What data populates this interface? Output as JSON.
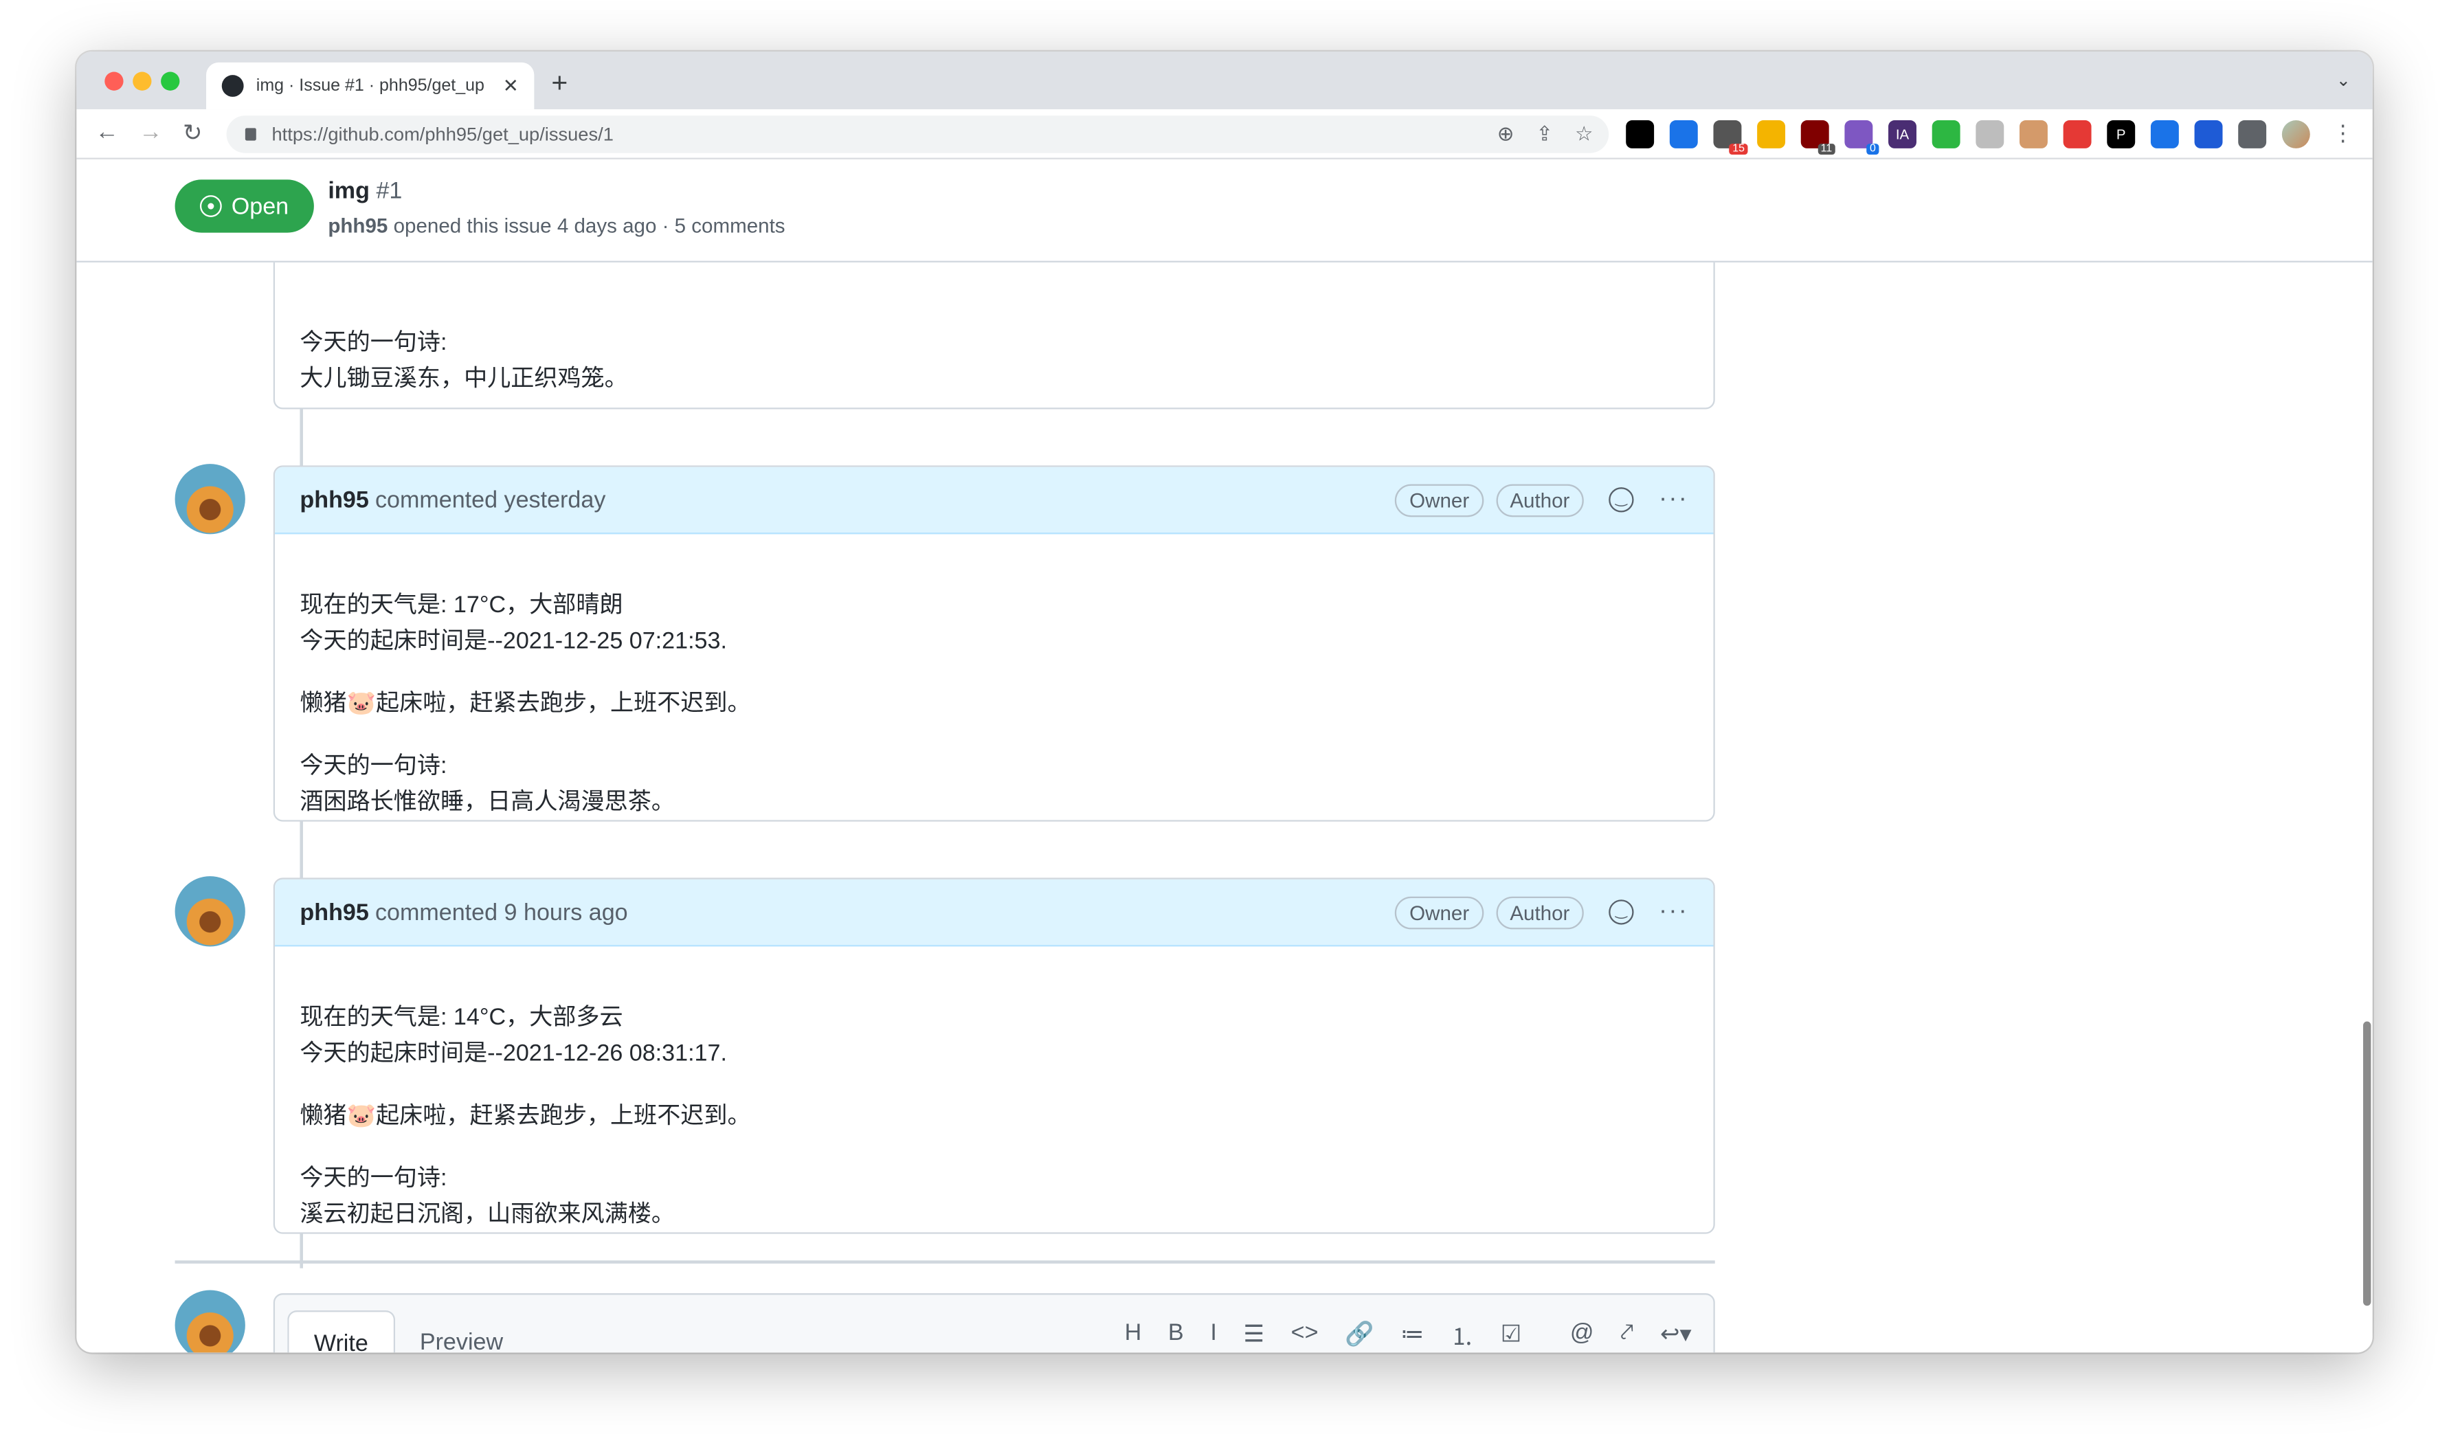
{
  "browser": {
    "tab_title": "img · Issue #1 · phh95/get_up",
    "url": "https://github.com/phh95/get_up/issues/1",
    "extensions": [
      {
        "name": "ext-dark",
        "color": "#000000"
      },
      {
        "name": "ext-blue-circle",
        "color": "#1a73e8"
      },
      {
        "name": "ext-grid",
        "color": "#555555",
        "badge": "15",
        "badge_color": "#e53935"
      },
      {
        "name": "ext-download",
        "color": "#f4b400"
      },
      {
        "name": "ext-ublock",
        "color": "#800000",
        "badge": "11",
        "badge_color": "#555555"
      },
      {
        "name": "ext-sync",
        "color": "#7e57c2",
        "badge": "0",
        "badge_color": "#1a73e8"
      },
      {
        "name": "ext-ia",
        "color": "#4a2d73",
        "text": "IA"
      },
      {
        "name": "ext-y",
        "color": "#2db742"
      },
      {
        "name": "ext-shield",
        "color": "#bdbdbd"
      },
      {
        "name": "ext-face",
        "color": "#d49a6a"
      },
      {
        "name": "ext-red-list",
        "color": "#e53935"
      },
      {
        "name": "ext-p",
        "color": "#000000",
        "text": "P"
      },
      {
        "name": "ext-file-down",
        "color": "#1a73e8"
      },
      {
        "name": "ext-scissors",
        "color": "#1e5bd6"
      },
      {
        "name": "ext-puzzle",
        "color": "#5f6368"
      }
    ]
  },
  "issue": {
    "state": "Open",
    "title": "img",
    "number": "#1",
    "author": "phh95",
    "meta": "opened this issue 4 days ago · 5 comments",
    "accent": "#2da44e"
  },
  "partial_comment": {
    "lines": [
      "今天的一句诗:",
      "大儿锄豆溪东，中儿正织鸡笼。"
    ]
  },
  "comments": [
    {
      "author": "phh95",
      "action": "commented yesterday",
      "badges": [
        "Owner",
        "Author"
      ],
      "paragraphs": [
        [
          "现在的天气是: 17°C，大部晴朗",
          "今天的起床时间是--2021-12-25 07:21:53."
        ],
        [
          "懒猪🐷起床啦，赶紧去跑步，上班不迟到。"
        ],
        [
          "今天的一句诗:",
          "酒困路长惟欲睡，日高人渴漫思茶。"
        ]
      ]
    },
    {
      "author": "phh95",
      "action": "commented 9 hours ago",
      "badges": [
        "Owner",
        "Author"
      ],
      "paragraphs": [
        [
          "现在的天气是: 14°C，大部多云",
          "今天的起床时间是--2021-12-26 08:31:17."
        ],
        [
          "懒猪🐷起床啦，赶紧去跑步，上班不迟到。"
        ],
        [
          "今天的一句诗:",
          "溪云初起日沉阁，山雨欲来风满楼。"
        ]
      ]
    }
  ],
  "editor": {
    "tabs": [
      "Write",
      "Preview"
    ],
    "tools": [
      {
        "icon": "heading-icon",
        "glyph": "H"
      },
      {
        "icon": "bold-icon",
        "glyph": "B"
      },
      {
        "icon": "italic-icon",
        "glyph": "I"
      },
      {
        "icon": "quote-icon",
        "glyph": "☰"
      },
      {
        "icon": "code-icon",
        "glyph": "<>"
      },
      {
        "icon": "link-icon",
        "glyph": "🔗"
      },
      {
        "icon": "bullet-list-icon",
        "glyph": "≔"
      },
      {
        "icon": "numbered-list-icon",
        "glyph": "⒈"
      },
      {
        "icon": "task-list-icon",
        "glyph": "☑"
      },
      {
        "icon": "mention-icon",
        "glyph": "@"
      },
      {
        "icon": "reference-icon",
        "glyph": "⤤"
      },
      {
        "icon": "reply-icon",
        "glyph": "↩▾"
      }
    ]
  }
}
